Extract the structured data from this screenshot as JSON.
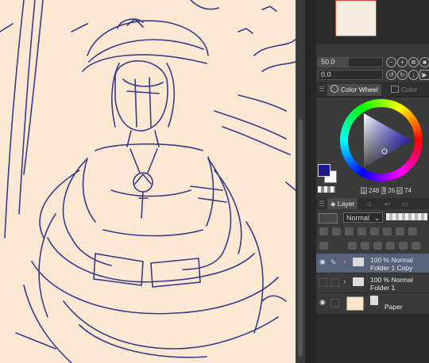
{
  "canvas": {
    "bg_color": "#fbe8d2",
    "stroke_color": "#2f2f7a"
  },
  "tool_property": {
    "size_value": "50.0",
    "opacity_value": "0.0"
  },
  "color_panel": {
    "tab_color_wheel": "Color Wheel",
    "tab_color_set": "Color Set",
    "main_color": "#1a1a8a",
    "sub_color": "#ffffff",
    "h_label": "H",
    "h_value": "248",
    "l_label": "L",
    "l_value": "26",
    "s_label": "S",
    "s_value": "74"
  },
  "layer_panel": {
    "tab_layer": "Layer",
    "blend_mode": "Normal",
    "layers": [
      {
        "opacity": "100 %",
        "mode": "Normal",
        "name": "Folder 1 Copy",
        "selected": true
      },
      {
        "opacity": "100 %",
        "mode": "Normal",
        "name": "Folder 1",
        "selected": false
      },
      {
        "name": "Paper",
        "selected": false
      }
    ]
  }
}
